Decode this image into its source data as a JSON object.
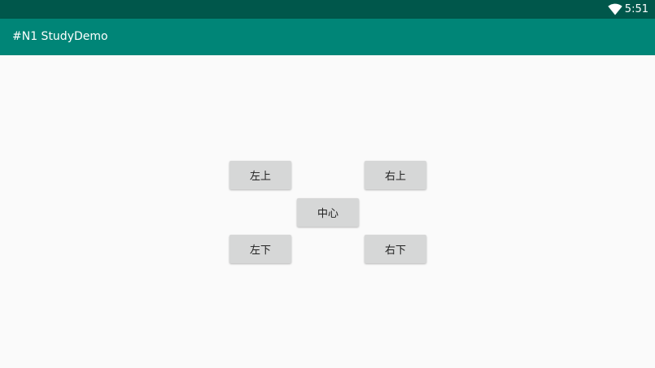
{
  "status_bar": {
    "time": "5:51",
    "wifi_icon": "wifi-icon",
    "background": "#00574b"
  },
  "app_bar": {
    "title": "#N1 StudyDemo",
    "background": "#008577"
  },
  "buttons": {
    "top_left": "左上",
    "top_right": "右上",
    "center": "中心",
    "bottom_left": "左下",
    "bottom_right": "右下"
  }
}
